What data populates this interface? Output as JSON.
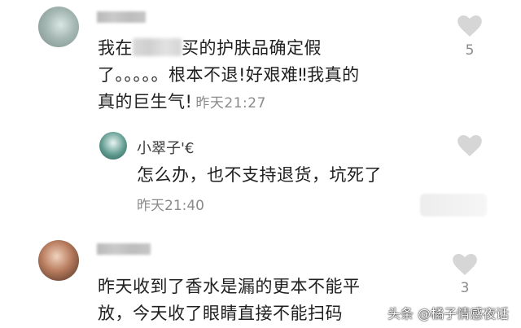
{
  "comments": [
    {
      "text_before_blur": "我在",
      "text_after_blur": "买的护肤品确定假",
      "line2": "了。。。。。根本不退!好艰难‼我真的",
      "line3": "真的巨生气!",
      "time": "昨天21:27",
      "likes": "5"
    },
    {
      "text_line1": "昨天收到了香水是漏的更本不能平",
      "text_line2": "放，今天收了眼睛直接不能扫码",
      "likes": "3"
    }
  ],
  "reply": {
    "author": "小翠子'€",
    "text": "怎么办，也不支持退货，坑死了",
    "time": "昨天21:40"
  },
  "watermark": "头条 @橘子情感夜话",
  "colors": {
    "text": "#202020",
    "time": "#8a8a8a",
    "like_icon": "#d6d6d6"
  }
}
